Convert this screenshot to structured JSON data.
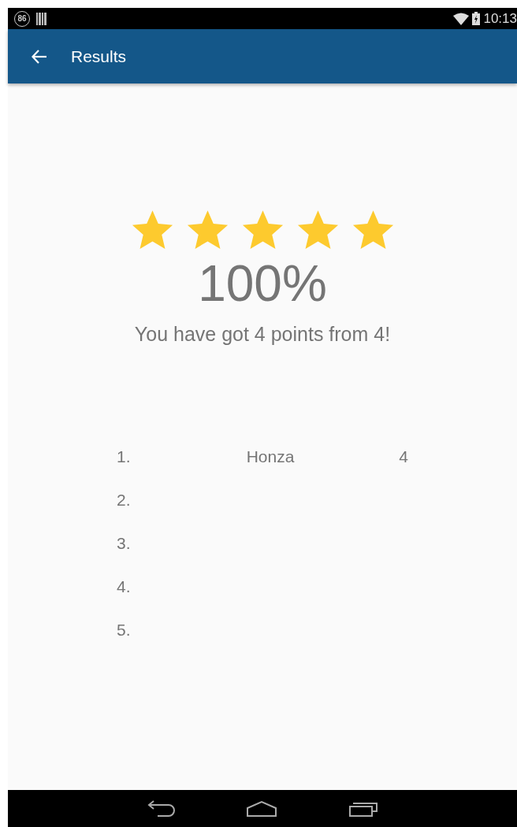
{
  "status_bar": {
    "notification_badge": "86",
    "time": "10:13"
  },
  "app_bar": {
    "title": "Results"
  },
  "rating": {
    "stars": 5
  },
  "score": {
    "percent": "100%",
    "message": "You have got 4 points from 4!"
  },
  "leaderboard": [
    {
      "rank": "1.",
      "name": "Honza",
      "points": "4"
    },
    {
      "rank": "2."
    },
    {
      "rank": "3."
    },
    {
      "rank": "4."
    },
    {
      "rank": "5."
    }
  ]
}
